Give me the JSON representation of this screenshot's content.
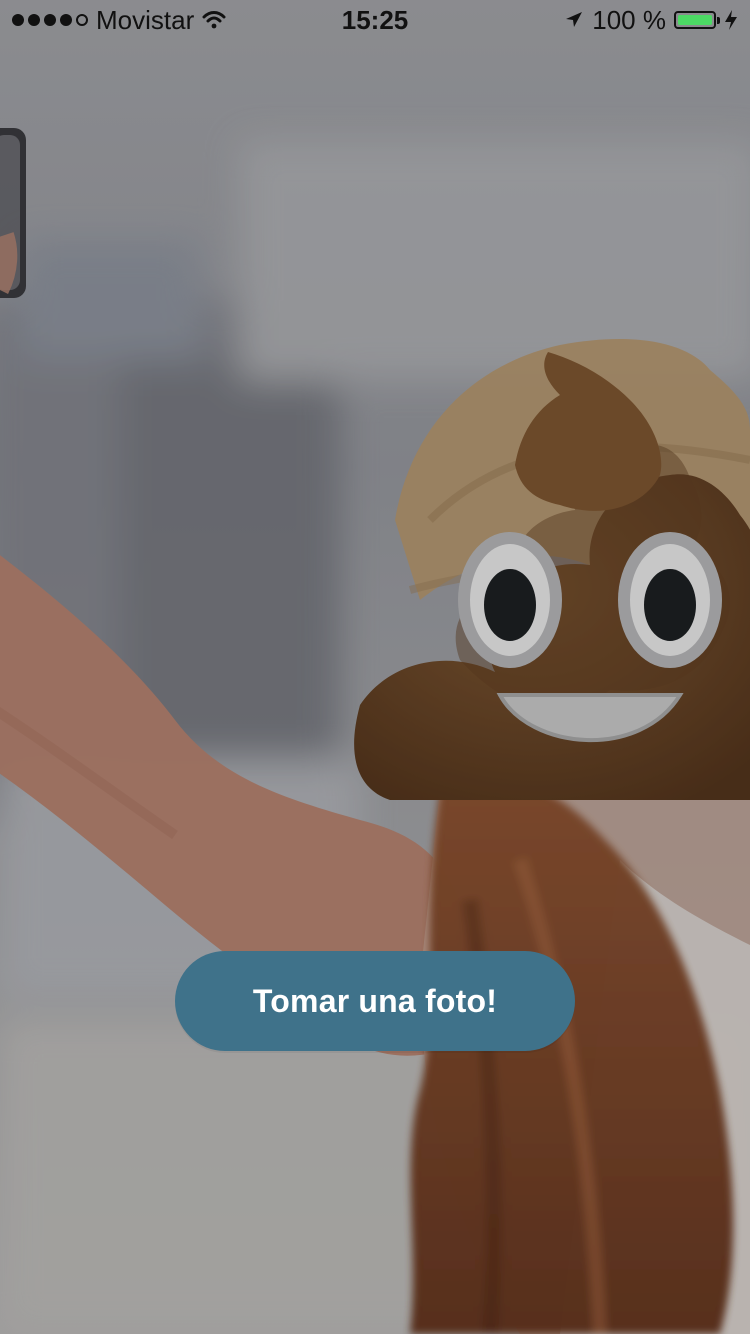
{
  "status_bar": {
    "carrier": "Movistar",
    "time": "15:25",
    "battery_percent": "100 %",
    "signal_bars": 4,
    "signal_total": 5,
    "icons": {
      "wifi": "wifi-icon",
      "location": "location-arrow-icon",
      "battery": "battery-icon",
      "charging": "charging-bolt-icon"
    },
    "battery_color": "#4cd964"
  },
  "main": {
    "take_photo_label": "Tomar una foto!",
    "button_color": "#3f728a"
  },
  "scene": {
    "emoji": "poop-emoji",
    "background": "blurred-selfie-photo"
  }
}
